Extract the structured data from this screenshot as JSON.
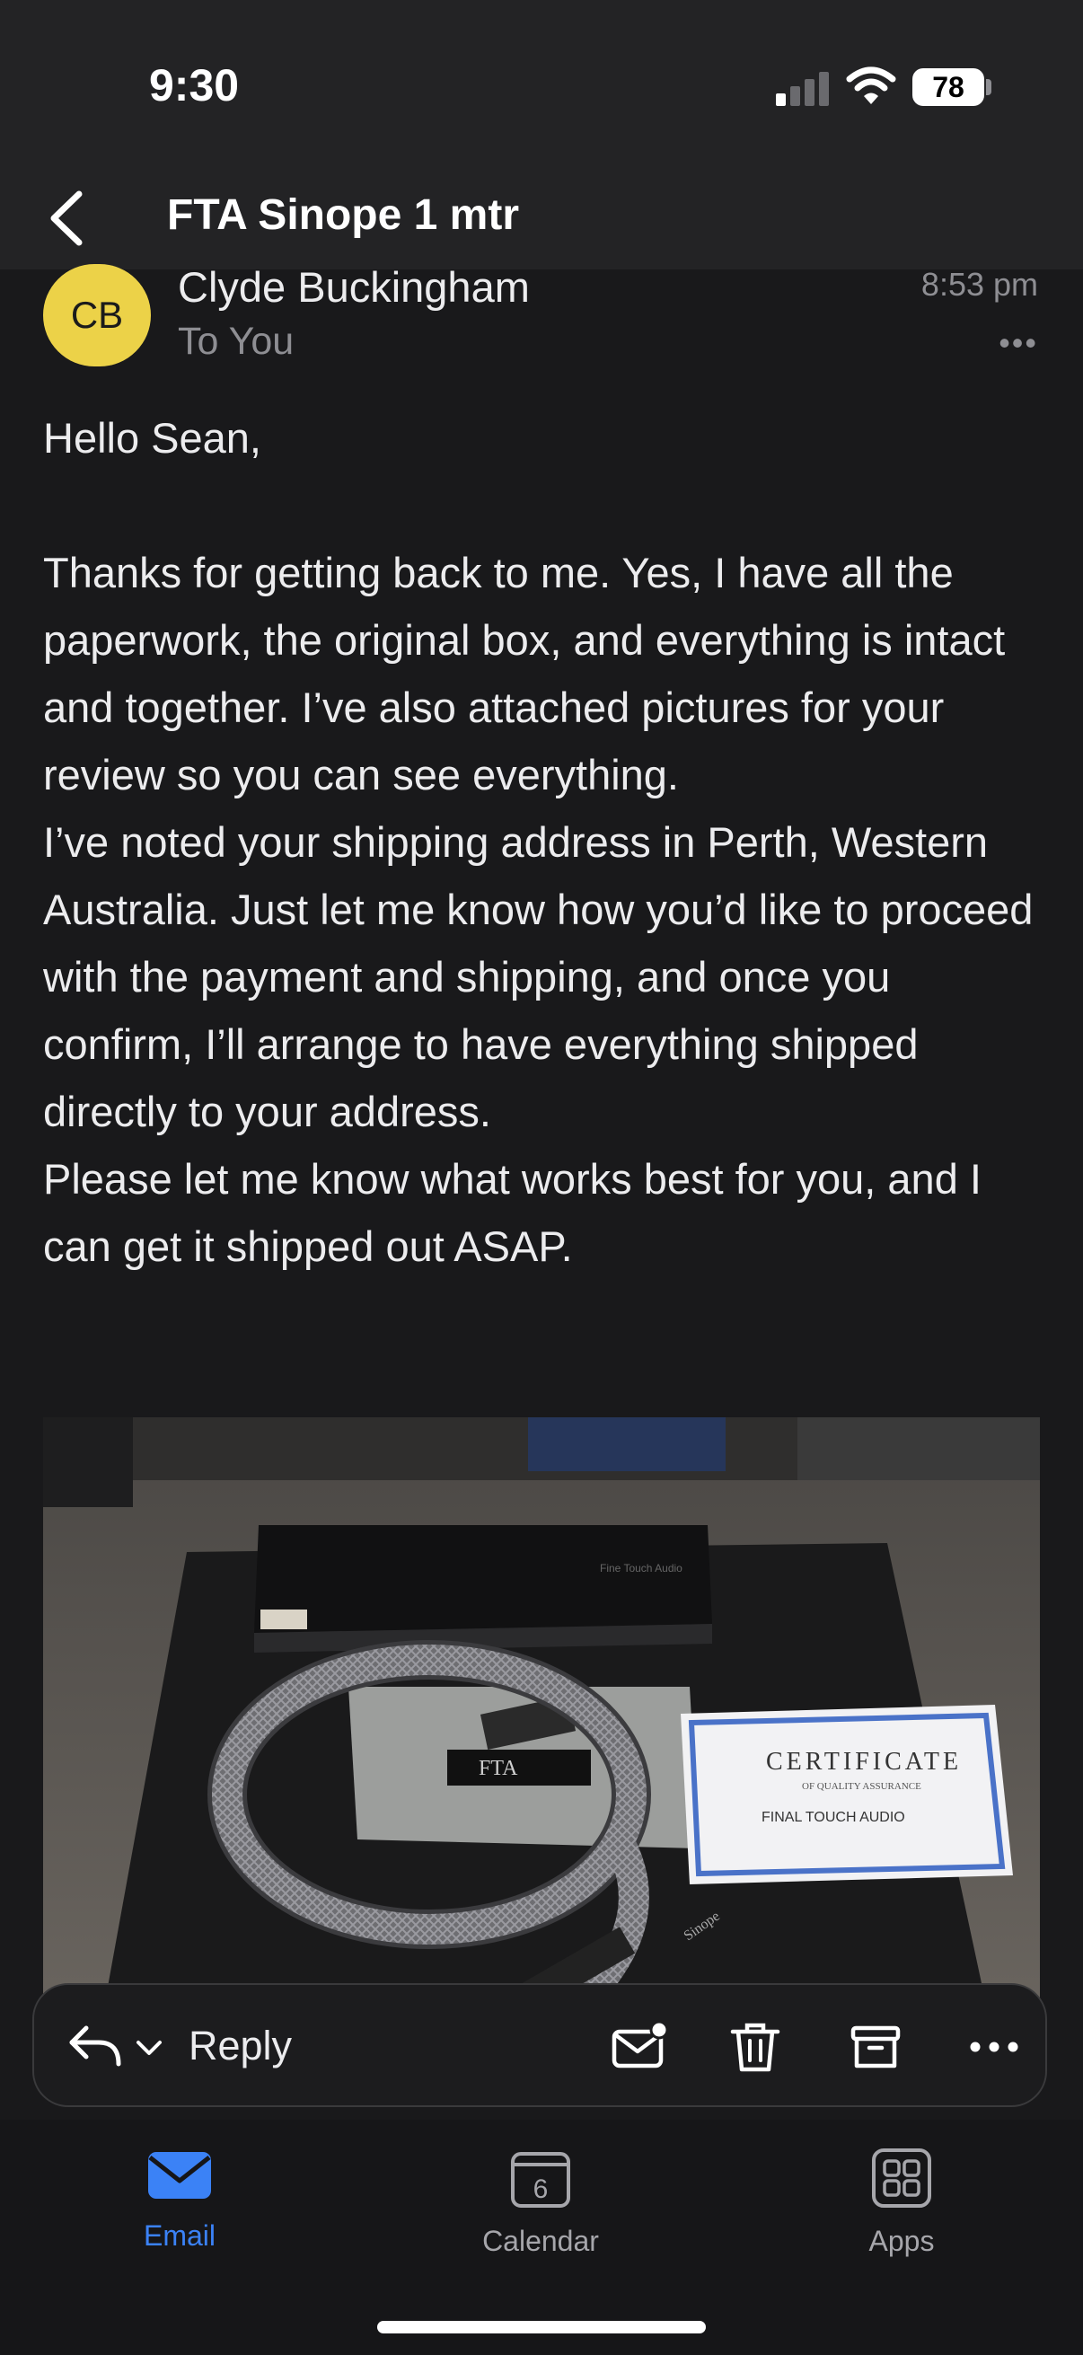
{
  "status_bar": {
    "time": "9:30",
    "battery": "78"
  },
  "header": {
    "subject": "FTA Sinope 1 mtr"
  },
  "message": {
    "avatar_initials": "CB",
    "sender": "Clyde Buckingham",
    "recipient": "To You",
    "time": "8:53 pm",
    "more": "•••",
    "greeting": "Hello Sean,",
    "paragraphs": [
      "Thanks for getting back to me. Yes, I have all the paperwork, the original box, and everything is intact and together. I’ve also attached pictures for your review so you can see everything.",
      "I’ve noted your shipping address in Perth, Western Australia. Just let me know how you’d like to proceed with the payment and shipping, and once you confirm, I’ll arrange to have everything shipped directly to your address.",
      "Please let me know what works best for you, and I can get it shipped out ASAP."
    ],
    "attachment": {
      "box_label": "Fine Touch Audio",
      "pouch_logo": "FTA",
      "certificate_title": "CERTIFICATE",
      "certificate_subtitle": "OF QUALITY ASSURANCE",
      "certificate_line": "FINAL TOUCH AUDIO",
      "cable_text": "Sinope"
    }
  },
  "toolbar": {
    "reply_label": "Reply",
    "icons": [
      "reply-icon",
      "chevron-down-icon",
      "mark-unread-icon",
      "trash-icon",
      "archive-icon",
      "more-icon"
    ]
  },
  "tabs": [
    {
      "label": "Email",
      "icon": "mail-icon",
      "active": true
    },
    {
      "label": "Calendar",
      "icon": "calendar-icon",
      "badge": "6",
      "active": false
    },
    {
      "label": "Apps",
      "icon": "apps-grid-icon",
      "active": false
    }
  ],
  "colors": {
    "accent": "#3b82f6",
    "avatar": "#ecd248",
    "background": "#19191b"
  }
}
